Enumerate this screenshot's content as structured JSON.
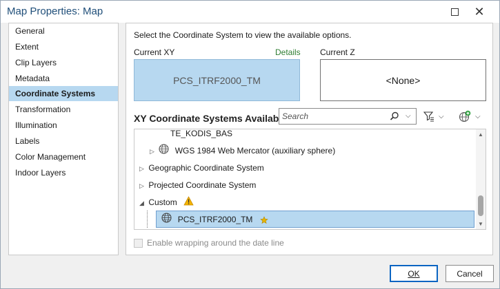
{
  "window": {
    "title": "Map Properties: Map"
  },
  "sidebar": {
    "items": [
      {
        "label": "General"
      },
      {
        "label": "Extent"
      },
      {
        "label": "Clip Layers"
      },
      {
        "label": "Metadata"
      },
      {
        "label": "Coordinate Systems",
        "active": true
      },
      {
        "label": "Transformation"
      },
      {
        "label": "Illumination"
      },
      {
        "label": "Labels"
      },
      {
        "label": "Color Management"
      },
      {
        "label": "Indoor Layers"
      }
    ]
  },
  "main": {
    "instruction": "Select the Coordinate System to view the available options.",
    "current_xy_label": "Current XY",
    "details_link": "Details",
    "current_z_label": "Current Z",
    "current_xy_value": "PCS_ITRF2000_TM",
    "current_z_value": "<None>",
    "available_heading": "XY Coordinate Systems Available",
    "search_placeholder": "Search",
    "tree": [
      {
        "label": "TE_KODIS_BAS",
        "indent": 1,
        "type": "cut"
      },
      {
        "label": "WGS 1984 Web Mercator (auxiliary sphere)",
        "indent": 1,
        "type": "globe-expand"
      },
      {
        "label": "Geographic Coordinate System",
        "indent": 0,
        "type": "folder"
      },
      {
        "label": "Projected Coordinate System",
        "indent": 0,
        "type": "folder"
      },
      {
        "label": "Custom",
        "indent": 0,
        "type": "expanded-warning"
      },
      {
        "label": "PCS_ITRF2000_TM",
        "indent": 1,
        "type": "selected"
      }
    ],
    "wrap_label": "Enable wrapping around the date line"
  },
  "footer": {
    "ok_label": "OK",
    "cancel_label": "Cancel"
  },
  "colors": {
    "selection": "#b7d8f0",
    "details_link": "#2e7d32",
    "title_text": "#1f4e79"
  }
}
